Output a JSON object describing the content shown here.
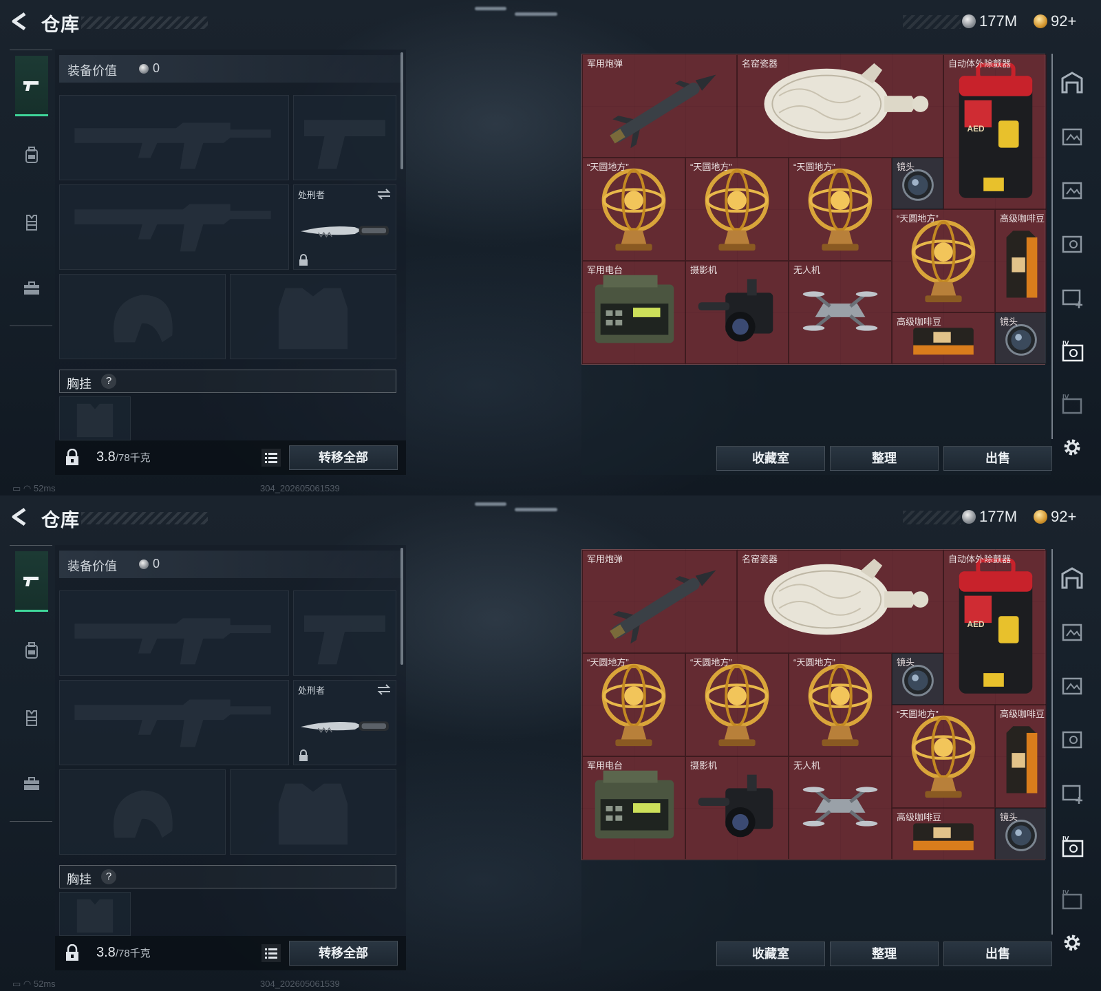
{
  "screens": [
    {
      "header": {
        "title": "仓库",
        "currency": [
          {
            "icon": "silver-coin-icon",
            "value": "177M"
          },
          {
            "icon": "gold-coin-icon",
            "value": "92+"
          }
        ]
      },
      "nav": [
        "weapon-tab",
        "backpack-tab",
        "armor-tab",
        "toolbox-tab"
      ],
      "equipment": {
        "value_label": "装备价值",
        "value": "0",
        "knife_slot_label": "处刑者",
        "chest_label": "胸挂",
        "chest_help": "?",
        "weight": "3.8",
        "weight_max": "/78千克",
        "transfer_all": "转移全部"
      },
      "status": {
        "ping": "52ms",
        "build": "304_202605061539"
      },
      "stash": {
        "items": [
          {
            "label": "军用炮弹",
            "kind": "missile"
          },
          {
            "label": "名窑瓷器",
            "kind": "vase"
          },
          {
            "label": "自动体外除颤器",
            "kind": "aed"
          },
          {
            "label": "“天圆地方”",
            "kind": "globe"
          },
          {
            "label": "“天圆地方”",
            "kind": "globe"
          },
          {
            "label": "“天圆地方”",
            "kind": "globe"
          },
          {
            "label": "镜头",
            "kind": "lens"
          },
          {
            "label": "“天圆地方”",
            "kind": "globe"
          },
          {
            "label": "高级咖啡豆",
            "kind": "coffee"
          },
          {
            "label": "军用电台",
            "kind": "radio"
          },
          {
            "label": "摄影机",
            "kind": "camera"
          },
          {
            "label": "无人机",
            "kind": "drone"
          },
          {
            "label": "高级咖啡豆",
            "kind": "coffee2"
          },
          {
            "label": "镜头",
            "kind": "lens"
          }
        ],
        "buttons": {
          "collection": "收藏室",
          "sort": "整理",
          "sell": "出售"
        }
      }
    },
    {
      "header": {
        "title": "仓库",
        "currency": [
          {
            "icon": "silver-coin-icon",
            "value": "177M"
          },
          {
            "icon": "gold-coin-icon",
            "value": "92+"
          }
        ]
      },
      "nav": [
        "weapon-tab",
        "backpack-tab",
        "armor-tab",
        "toolbox-tab"
      ],
      "equipment": {
        "value_label": "装备价值",
        "value": "0",
        "knife_slot_label": "处刑者",
        "chest_label": "胸挂",
        "chest_help": "?",
        "weight": "3.8",
        "weight_max": "/78千克",
        "transfer_all": "转移全部"
      },
      "status": {
        "ping": "52ms",
        "build": "304_202605061539"
      },
      "stash": {
        "items": [
          {
            "label": "军用炮弹",
            "kind": "missile"
          },
          {
            "label": "名窑瓷器",
            "kind": "vase"
          },
          {
            "label": "自动体外除颤器",
            "kind": "aed"
          },
          {
            "label": "“天圆地方”",
            "kind": "globe"
          },
          {
            "label": "“天圆地方”",
            "kind": "globe"
          },
          {
            "label": "“天圆地方”",
            "kind": "globe"
          },
          {
            "label": "镜头",
            "kind": "lens"
          },
          {
            "label": "“天圆地方”",
            "kind": "globe"
          },
          {
            "label": "高级咖啡豆",
            "kind": "coffee"
          },
          {
            "label": "军用电台",
            "kind": "radio"
          },
          {
            "label": "摄影机",
            "kind": "camera"
          },
          {
            "label": "无人机",
            "kind": "drone"
          },
          {
            "label": "高级咖啡豆",
            "kind": "coffee2"
          },
          {
            "label": "镜头",
            "kind": "lens"
          }
        ],
        "buttons": {
          "collection": "收藏室",
          "sort": "整理",
          "sell": "出售"
        }
      }
    }
  ],
  "colors": {
    "accent": "#3fd69a",
    "stash_bg": "#5a2a30",
    "gold": "#d3962f"
  }
}
